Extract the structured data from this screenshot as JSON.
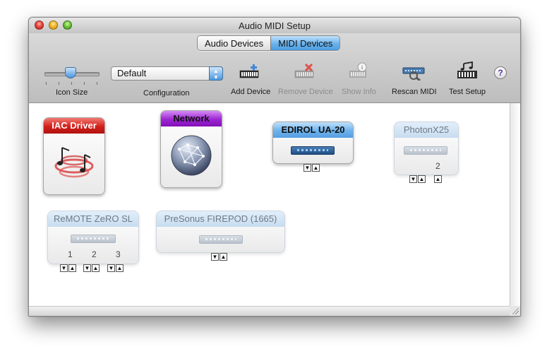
{
  "window": {
    "title": "Audio MIDI Setup"
  },
  "tabs": [
    {
      "label": "Audio Devices",
      "active": false
    },
    {
      "label": "MIDI Devices",
      "active": true
    }
  ],
  "toolbar": {
    "icon_size_label": "Icon Size",
    "configuration_label": "Configuration",
    "configuration_value": "Default",
    "add_device_label": "Add Device",
    "remove_device_label": "Remove Device",
    "show_info_label": "Show Info",
    "rescan_midi_label": "Rescan MIDI",
    "test_setup_label": "Test Setup",
    "help_label": "?"
  },
  "devices": {
    "iac": {
      "name": "IAC Driver",
      "color": "#d3201a",
      "icon": "midi-notes-icon"
    },
    "network": {
      "name": "Network",
      "color": "#9b25d1",
      "icon": "network-globe-icon"
    },
    "edirol": {
      "name": "EDIROL UA-20",
      "color": "#6db2eb",
      "icon": "midi-interface-icon"
    },
    "photon": {
      "name": "PhotonX25",
      "port": "2",
      "offline": true
    },
    "remote": {
      "name": "ReMOTE ZeRO SL",
      "ports": [
        "1",
        "2",
        "3"
      ],
      "offline": true
    },
    "presonus": {
      "name": "PreSonus FIREPOD (1665)",
      "offline": true
    }
  },
  "icons": {
    "close": "close-button-icon",
    "minimize": "minimize-button-icon",
    "zoom": "zoom-button-icon",
    "help": "help-icon",
    "port_arrow_down": "▼",
    "port_arrow_up": "▲"
  }
}
